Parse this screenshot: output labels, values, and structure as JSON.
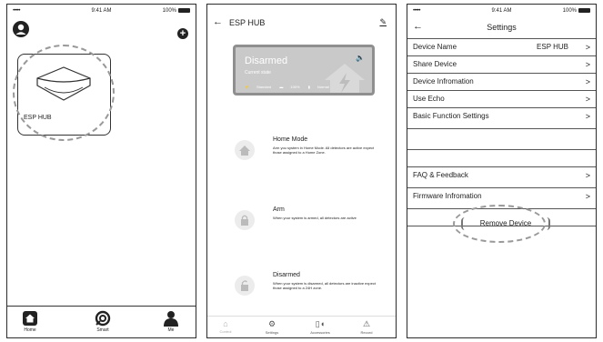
{
  "status": {
    "carrier_dots": "•••••",
    "time": "9:41 AM",
    "battery": "100%"
  },
  "home": {
    "device_name": "ESP HUB",
    "tabs": [
      {
        "label": "Home",
        "icon": "home-icon"
      },
      {
        "label": "Smart",
        "icon": "smart-icon"
      },
      {
        "label": "Me",
        "icon": "person-icon"
      }
    ]
  },
  "hub": {
    "title": "ESP HUB",
    "state_title": "Disarmed",
    "state_sub": "Current state",
    "state_info": [
      "Standard",
      "100%",
      "Normal"
    ],
    "modes": [
      {
        "title": "Home Mode",
        "desc": "Arm you system in Home Mode. All detectors are active expect those assigned to a Home Zone."
      },
      {
        "title": "Arm",
        "desc": "When your system is armed, all detectors are active"
      },
      {
        "title": "Disarmed",
        "desc": "When your system is disarmed, all detectors are inactive expect those assigned to a 24H zone."
      }
    ],
    "bottom_tabs": [
      "Control",
      "Settings",
      "Accessories",
      "Record"
    ]
  },
  "settings": {
    "title": "Settings",
    "rows": [
      {
        "label": "Device Name",
        "value": "ESP HUB"
      },
      {
        "label": "Share Device",
        "value": ""
      },
      {
        "label": "Device Infromation",
        "value": ""
      },
      {
        "label": "Use Echo",
        "value": ""
      },
      {
        "label": "Basic Function Settings",
        "value": ""
      },
      {
        "label": "",
        "value": ""
      },
      {
        "label": "",
        "value": ""
      },
      {
        "label": "FAQ & Feedback",
        "value": ""
      },
      {
        "label": "Firmware Infromation",
        "value": ""
      },
      {
        "label": "",
        "value": ""
      }
    ],
    "remove_label": "Remove Device"
  }
}
